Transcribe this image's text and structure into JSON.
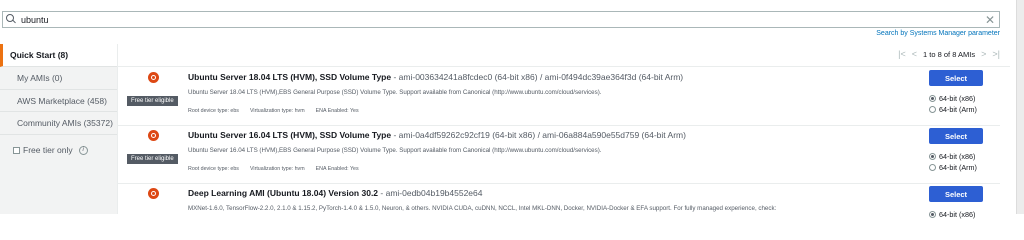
{
  "search": {
    "value": "ubuntu"
  },
  "ssm_link": "Search by Systems Manager parameter",
  "sidebar": {
    "items": [
      {
        "label": "Quick Start (8)",
        "active": true
      },
      {
        "label": "My AMIs (0)"
      },
      {
        "label": "AWS Marketplace (458)"
      },
      {
        "label": "Community AMIs (35372)"
      }
    ],
    "free_tier_label": "Free tier only"
  },
  "pager": {
    "text": "1 to 8 of 8 AMIs"
  },
  "amis": [
    {
      "name": "Ubuntu Server 18.04 LTS (HVM), SSD Volume Type",
      "ids": " - ami-003634241a8fcdec0 (64-bit x86) / ami-0f494dc39ae364f3d (64-bit Arm)",
      "desc": "Ubuntu Server 18.04 LTS (HVM),EBS General Purpose (SSD) Volume Type. Support available from Canonical (http://www.ubuntu.com/cloud/services).",
      "meta": [
        "Root device type: ebs",
        "Virtualization type: hvm",
        "ENA Enabled: Yes"
      ],
      "free_tier": "Free tier eligible",
      "select": "Select",
      "arch": [
        "64-bit (x86)",
        "64-bit (Arm)"
      ]
    },
    {
      "name": "Ubuntu Server 16.04 LTS (HVM), SSD Volume Type",
      "ids": " - ami-0a4df59262c92cf19 (64-bit x86) / ami-06a884a590e55d759 (64-bit Arm)",
      "desc": "Ubuntu Server 16.04 LTS (HVM),EBS General Purpose (SSD) Volume Type. Support available from Canonical (http://www.ubuntu.com/cloud/services).",
      "meta": [
        "Root device type: ebs",
        "Virtualization type: hvm",
        "ENA Enabled: Yes"
      ],
      "free_tier": "Free tier eligible",
      "select": "Select",
      "arch": [
        "64-bit (x86)",
        "64-bit (Arm)"
      ]
    },
    {
      "name": "Deep Learning AMI (Ubuntu 18.04) Version 30.2",
      "ids": " - ami-0edb04b19b4552e64",
      "desc": "MXNet-1.6.0, TensorFlow-2.2.0, 2.1.0 & 1.15.2, PyTorch-1.4.0 & 1.5.0, Neuron, & others. NVIDIA CUDA, cuDNN, NCCL, Intel MKL-DNN, Docker, NVIDIA-Docker & EFA support. For fully managed experience, check:",
      "select": "Select",
      "arch": [
        "64-bit (x86)"
      ]
    }
  ],
  "colors": {
    "accent": "#ec7211",
    "button": "#2d5fd3",
    "link": "#0073bb"
  }
}
